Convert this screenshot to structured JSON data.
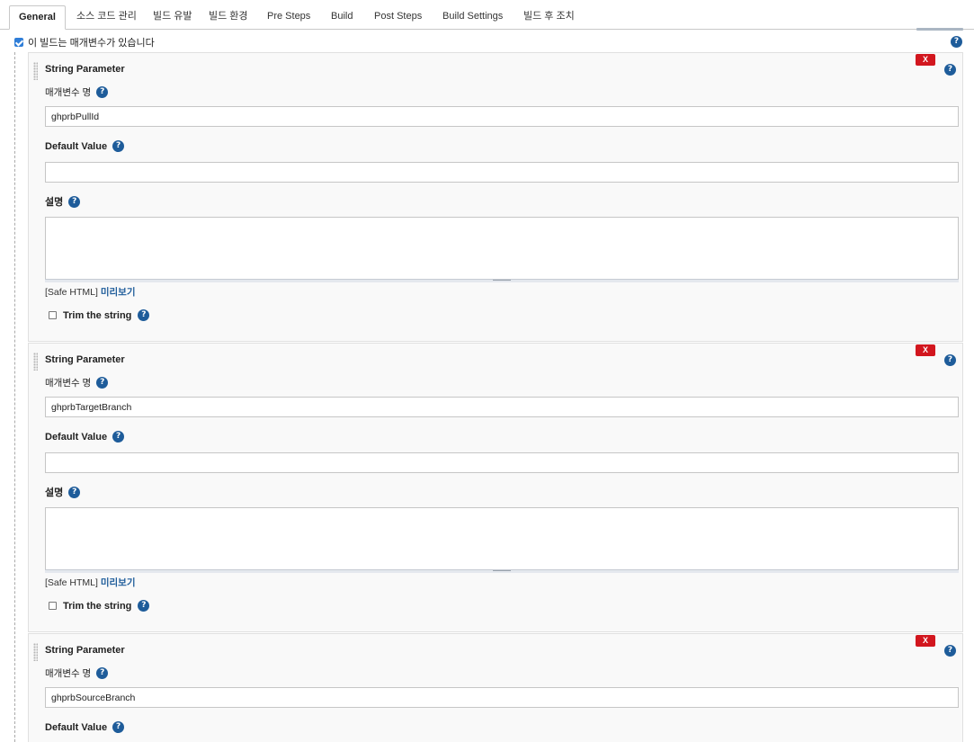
{
  "tabs": [
    {
      "label": "General",
      "active": true
    },
    {
      "label": "소스 코드 관리"
    },
    {
      "label": "빌드 유발"
    },
    {
      "label": "빌드 환경"
    },
    {
      "label": "Pre Steps"
    },
    {
      "label": "Build"
    },
    {
      "label": "Post Steps"
    },
    {
      "label": "Build Settings"
    },
    {
      "label": "빌드 후 조치"
    }
  ],
  "parameterized": {
    "checked": true,
    "label": "이 빌드는 매개변수가 있습니다"
  },
  "help_glyph": "?",
  "delete_label": "X",
  "field_labels": {
    "name": "매개변수 명",
    "default": "Default Value",
    "description": "설명",
    "safe_html": "[Safe HTML]",
    "preview": "미리보기",
    "trim": "Trim the string"
  },
  "parameters": [
    {
      "type": "String Parameter",
      "name": "ghprbPullId",
      "default_value": "",
      "description": "",
      "trim": false
    },
    {
      "type": "String Parameter",
      "name": "ghprbTargetBranch",
      "default_value": "",
      "description": "",
      "trim": false
    },
    {
      "type": "String Parameter",
      "name": "ghprbSourceBranch",
      "default_value": "",
      "description": "",
      "trim": false
    }
  ],
  "colors": {
    "help_icon": "#1e5c9a",
    "delete_button": "#d2161e",
    "link": "#1e5c9a",
    "checkbox": "#2f7ed8"
  }
}
